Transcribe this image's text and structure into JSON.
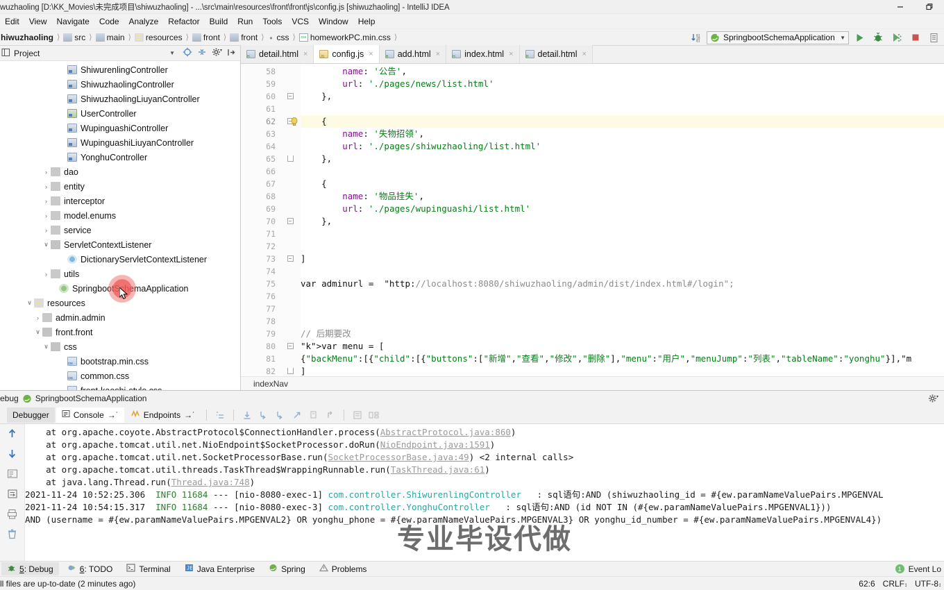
{
  "window": {
    "title": "wuzhaoling [D:\\KK_Movies\\未完成项目\\shiwuzhaoling] - ...\\src\\main\\resources\\front\\front\\js\\config.js [shiwuzhaoling] - IntelliJ IDEA",
    "minimize_label": "minimize",
    "restore_label": "restore"
  },
  "menubar": {
    "items": [
      "Edit",
      "View",
      "Navigate",
      "Code",
      "Analyze",
      "Refactor",
      "Build",
      "Run",
      "Tools",
      "VCS",
      "Window",
      "Help"
    ]
  },
  "breadcrumb": {
    "items": [
      {
        "label": "hiwuzhaoling",
        "icon": "project-icon",
        "bold": true
      },
      {
        "label": "src",
        "icon": "folder-icon"
      },
      {
        "label": "main",
        "icon": "folder-icon"
      },
      {
        "label": "resources",
        "icon": "resources-folder-icon"
      },
      {
        "label": "front",
        "icon": "folder-icon"
      },
      {
        "label": "front",
        "icon": "folder-icon"
      },
      {
        "label": "css",
        "icon": "dot-icon"
      },
      {
        "label": "homeworkPC.min.css",
        "icon": "css-file-icon"
      }
    ]
  },
  "toolbar": {
    "run_config": "SpringbootSchemaApplication",
    "run_label": "Run",
    "debug_label": "Debug",
    "coverage_label": "Run with Coverage",
    "stop_label": "Stop",
    "update_label": "Update application"
  },
  "project_panel": {
    "title": "Project",
    "tree": [
      {
        "label": "ShiwurenlingController",
        "indent": 7,
        "arrow": "",
        "icon": "java-class-icon"
      },
      {
        "label": "ShiwuzhaolingController",
        "indent": 7,
        "arrow": "",
        "icon": "java-class-icon"
      },
      {
        "label": "ShiwuzhaolingLiuyanController",
        "indent": 7,
        "arrow": "",
        "icon": "java-class-icon"
      },
      {
        "label": "UserController",
        "indent": 7,
        "arrow": "",
        "icon": "java-class-green-icon"
      },
      {
        "label": "WupinguashiController",
        "indent": 7,
        "arrow": "",
        "icon": "java-class-icon"
      },
      {
        "label": "WupinguashiLiuyanController",
        "indent": 7,
        "arrow": "",
        "icon": "java-class-icon"
      },
      {
        "label": "YonghuController",
        "indent": 7,
        "arrow": "",
        "icon": "java-class-icon"
      },
      {
        "label": "dao",
        "indent": 5,
        "arrow": "›",
        "icon": "folder-icon"
      },
      {
        "label": "entity",
        "indent": 5,
        "arrow": "›",
        "icon": "folder-icon"
      },
      {
        "label": "interceptor",
        "indent": 5,
        "arrow": "›",
        "icon": "folder-icon"
      },
      {
        "label": "model.enums",
        "indent": 5,
        "arrow": "›",
        "icon": "folder-icon"
      },
      {
        "label": "service",
        "indent": 5,
        "arrow": "›",
        "icon": "folder-icon"
      },
      {
        "label": "ServletContextListener",
        "indent": 5,
        "arrow": "∨",
        "icon": "folder-open-icon"
      },
      {
        "label": "DictionaryServletContextListener",
        "indent": 7,
        "arrow": "",
        "icon": "listener-class-icon"
      },
      {
        "label": "utils",
        "indent": 5,
        "arrow": "›",
        "icon": "folder-icon"
      },
      {
        "label": "SpringbootSchemaApplication",
        "indent": 6,
        "arrow": "",
        "icon": "spring-class-icon"
      },
      {
        "label": "resources",
        "indent": 3,
        "arrow": "∨",
        "icon": "resources-folder-icon"
      },
      {
        "label": "admin.admin",
        "indent": 4,
        "arrow": "›",
        "icon": "folder-icon"
      },
      {
        "label": "front.front",
        "indent": 4,
        "arrow": "∨",
        "icon": "folder-open-icon"
      },
      {
        "label": "css",
        "indent": 5,
        "arrow": "∨",
        "icon": "folder-open-icon"
      },
      {
        "label": "bootstrap.min.css",
        "indent": 7,
        "arrow": "",
        "icon": "css-file-icon"
      },
      {
        "label": "common.css",
        "indent": 7,
        "arrow": "",
        "icon": "css-file-icon"
      },
      {
        "label": "front-kaoshi-style.css",
        "indent": 7,
        "arrow": "",
        "icon": "css-file-icon"
      }
    ]
  },
  "editor": {
    "tabs": [
      {
        "label": "detail.html",
        "type": "html",
        "active": false
      },
      {
        "label": "config.js",
        "type": "js",
        "active": true
      },
      {
        "label": "add.html",
        "type": "html",
        "active": false
      },
      {
        "label": "index.html",
        "type": "html",
        "active": false
      },
      {
        "label": "detail.html",
        "type": "html",
        "active": false
      }
    ],
    "breadcrumb_bottom": "indexNav",
    "lines": [
      {
        "no": "58",
        "text": "        name: '公告',"
      },
      {
        "no": "59",
        "text": "        url: './pages/news/list.html'"
      },
      {
        "no": "60",
        "text": "    },"
      },
      {
        "no": "61",
        "text": ""
      },
      {
        "no": "62",
        "text": "    {"
      },
      {
        "no": "63",
        "text": "        name: '失物招领',"
      },
      {
        "no": "64",
        "text": "        url: './pages/shiwuzhaoling/list.html'"
      },
      {
        "no": "65",
        "text": "    },"
      },
      {
        "no": "66",
        "text": ""
      },
      {
        "no": "67",
        "text": "    {"
      },
      {
        "no": "68",
        "text": "        name: '物品挂失',"
      },
      {
        "no": "69",
        "text": "        url: './pages/wupinguashi/list.html'"
      },
      {
        "no": "70",
        "text": "    },"
      },
      {
        "no": "71",
        "text": ""
      },
      {
        "no": "72",
        "text": ""
      },
      {
        "no": "73",
        "text": "]"
      },
      {
        "no": "74",
        "text": ""
      },
      {
        "no": "75",
        "text": "var adminurl =  \"http://localhost:8080/shiwuzhaoling/admin/dist/index.html#/login\";"
      },
      {
        "no": "76",
        "text": ""
      },
      {
        "no": "77",
        "text": ""
      },
      {
        "no": "78",
        "text": ""
      },
      {
        "no": "79",
        "text": "// 后期要改"
      },
      {
        "no": "80",
        "text": "var menu = ["
      },
      {
        "no": "81",
        "text": "{\"backMenu\":[{\"child\":[{\"buttons\":[\"新增\",\"查看\",\"修改\",\"删除\"],\"menu\":\"用户\",\"menuJump\":\"列表\",\"tableName\":\"yonghu\"}],\"m"
      },
      {
        "no": "82",
        "text": "]"
      }
    ]
  },
  "debug_panel": {
    "title": "ebug",
    "config_name": "SpringbootSchemaApplication",
    "tabs": [
      {
        "label": "Debugger",
        "state": "selected"
      },
      {
        "label": "Console",
        "state": "active",
        "suffix": "→˙"
      },
      {
        "label": "Endpoints",
        "state": "normal",
        "suffix": "→˙"
      }
    ],
    "console_lines": [
      {
        "text": "    at org.apache.coyote.AbstractProtocol$ConnectionHandler.process(",
        "link": "AbstractProtocol.java:860",
        "tail": ")"
      },
      {
        "text": "    at org.apache.tomcat.util.net.NioEndpoint$SocketProcessor.doRun(",
        "link": "NioEndpoint.java:1591",
        "tail": ")"
      },
      {
        "text": "    at org.apache.tomcat.util.net.SocketProcessorBase.run(",
        "link": "SocketProcessorBase.java:49",
        "tail": ") <2 internal calls>"
      },
      {
        "text": "    at org.apache.tomcat.util.threads.TaskThread$WrappingRunnable.run(",
        "link": "TaskThread.java:61",
        "tail": ")"
      },
      {
        "text": "    at java.lang.Thread.run(",
        "link": "Thread.java:748",
        "tail": ")"
      }
    ],
    "log_lines": [
      {
        "ts": "2021-11-24 10:52:25.306",
        "level": "INFO",
        "pid": "11684",
        "dash": "---",
        "thread": "[nio-8080-exec-1]",
        "logger": "com.controller.ShiwurenlingController",
        "msg": ": sql语句:AND (shiwuzhaoling_id = #{ew.paramNameValuePairs.MPGENVAL"
      },
      {
        "ts": "2021-11-24 10:54:15.317",
        "level": "INFO",
        "pid": "11684",
        "dash": "---",
        "thread": "[nio-8080-exec-3]",
        "logger": "com.controller.YonghuController",
        "msg": ": sql语句:AND (id NOT IN (#{ew.paramNameValuePairs.MPGENVAL1}))"
      }
    ],
    "wrap_line": "AND (username = #{ew.paramNameValuePairs.MPGENVAL2} OR yonghu_phone = #{ew.paramNameValuePairs.MPGENVAL3} OR yonghu_id_number = #{ew.paramNameValuePairs.MPGENVAL4})",
    "watermark": "专业毕设代做"
  },
  "tool_windows": {
    "items": [
      {
        "num": "5",
        "label": "Debug",
        "icon": "debug-icon",
        "selected": true
      },
      {
        "num": "6",
        "label": "TODO",
        "icon": "todo-icon",
        "selected": false
      },
      {
        "num": "",
        "label": "Terminal",
        "icon": "terminal-icon",
        "selected": false
      },
      {
        "num": "",
        "label": "Java Enterprise",
        "icon": "java-enterprise-icon",
        "selected": false
      },
      {
        "num": "",
        "label": "Spring",
        "icon": "spring-icon",
        "selected": false
      },
      {
        "num": "",
        "label": "Problems",
        "icon": "problems-icon",
        "selected": false
      }
    ],
    "event_log": "Event Lo",
    "event_count": "1"
  },
  "statusbar": {
    "message": "ll files are up-to-date (2 minutes ago)",
    "caret": "62:6",
    "line_sep": "CRLF",
    "encoding": "UTF-8"
  }
}
